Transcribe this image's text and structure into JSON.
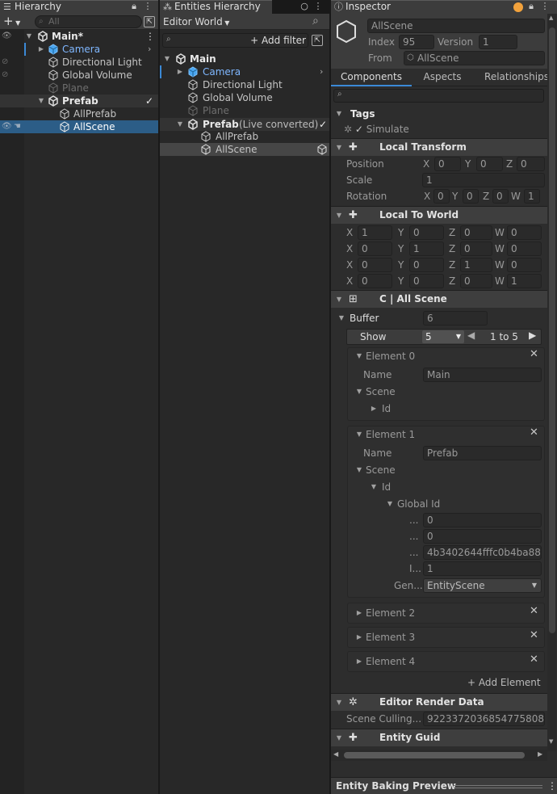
{
  "hierarchy": {
    "tab_title": "Hierarchy",
    "search_placeholder": "All",
    "add_label": "+",
    "items": [
      {
        "label": "Main*"
      },
      {
        "label": "Camera"
      },
      {
        "label": "Directional Light"
      },
      {
        "label": "Global Volume"
      },
      {
        "label": "Plane"
      },
      {
        "label": "Prefab"
      },
      {
        "label": "AllPrefab"
      },
      {
        "label": "AllScene"
      }
    ]
  },
  "entities": {
    "tab_title": "Entities Hierarchy",
    "world_dropdown": "Editor World",
    "add_filter": "Add filter",
    "items": [
      {
        "label": "Main"
      },
      {
        "label": "Camera"
      },
      {
        "label": "Directional Light"
      },
      {
        "label": "Global Volume"
      },
      {
        "label": "Plane"
      },
      {
        "label": "Prefab"
      },
      {
        "label": "(Live converted)"
      },
      {
        "label": "AllPrefab"
      },
      {
        "label": "AllScene"
      }
    ]
  },
  "inspector": {
    "tab_title": "Inspector",
    "entity_name": "AllScene",
    "index_label": "Index",
    "index_value": "95",
    "version_label": "Version",
    "version_value": "1",
    "from_label": "From",
    "from_value": "AllScene",
    "tabs": [
      "Components",
      "Aspects",
      "Relationships"
    ],
    "tags": {
      "title": "Tags",
      "simulate": "Simulate"
    },
    "local_transform": {
      "title": "Local Transform",
      "position_label": "Position",
      "position": [
        "0",
        "0",
        "0"
      ],
      "scale_label": "Scale",
      "scale": "1",
      "rotation_label": "Rotation",
      "rotation": [
        "0",
        "0",
        "0",
        "1"
      ]
    },
    "local_to_world": {
      "title": "Local To World",
      "rows": [
        [
          "1",
          "0",
          "0",
          "0"
        ],
        [
          "0",
          "1",
          "0",
          "0"
        ],
        [
          "0",
          "0",
          "1",
          "0"
        ],
        [
          "0",
          "0",
          "0",
          "1"
        ]
      ]
    },
    "all_scene": {
      "title": "C | All Scene",
      "buffer_label": "Buffer",
      "buffer_value": "6",
      "show_label": "Show",
      "show_value": "5",
      "range": "1 to 5",
      "element0": {
        "title": "Element 0",
        "name_label": "Name",
        "name_value": "Main",
        "scene": "Scene",
        "id": "Id"
      },
      "element1": {
        "title": "Element 1",
        "name_label": "Name",
        "name_value": "Prefab",
        "scene": "Scene",
        "id": "Id",
        "global_id": "Global Id",
        "field_labels": [
          "...",
          "...",
          "...",
          "I..."
        ],
        "field_values": [
          "0",
          "0",
          "4b3402644fffc0b4ba88",
          "1"
        ],
        "gen_label": "Gen...",
        "gen_value": "EntityScene"
      },
      "element2": "Element 2",
      "element3": "Element 3",
      "element4": "Element 4",
      "add_element": "+ Add Element"
    },
    "editor_render_data": {
      "title": "Editor Render Data",
      "label": "Scene Culling...",
      "value": "9223372036854775808"
    },
    "entity_guid": {
      "title": "Entity Guid"
    },
    "baking_preview": "Entity Baking Preview"
  },
  "colors": {
    "selection": "#2c5d87",
    "accent_blue": "#7fb7ff",
    "notify_orange": "#f2a23c"
  }
}
